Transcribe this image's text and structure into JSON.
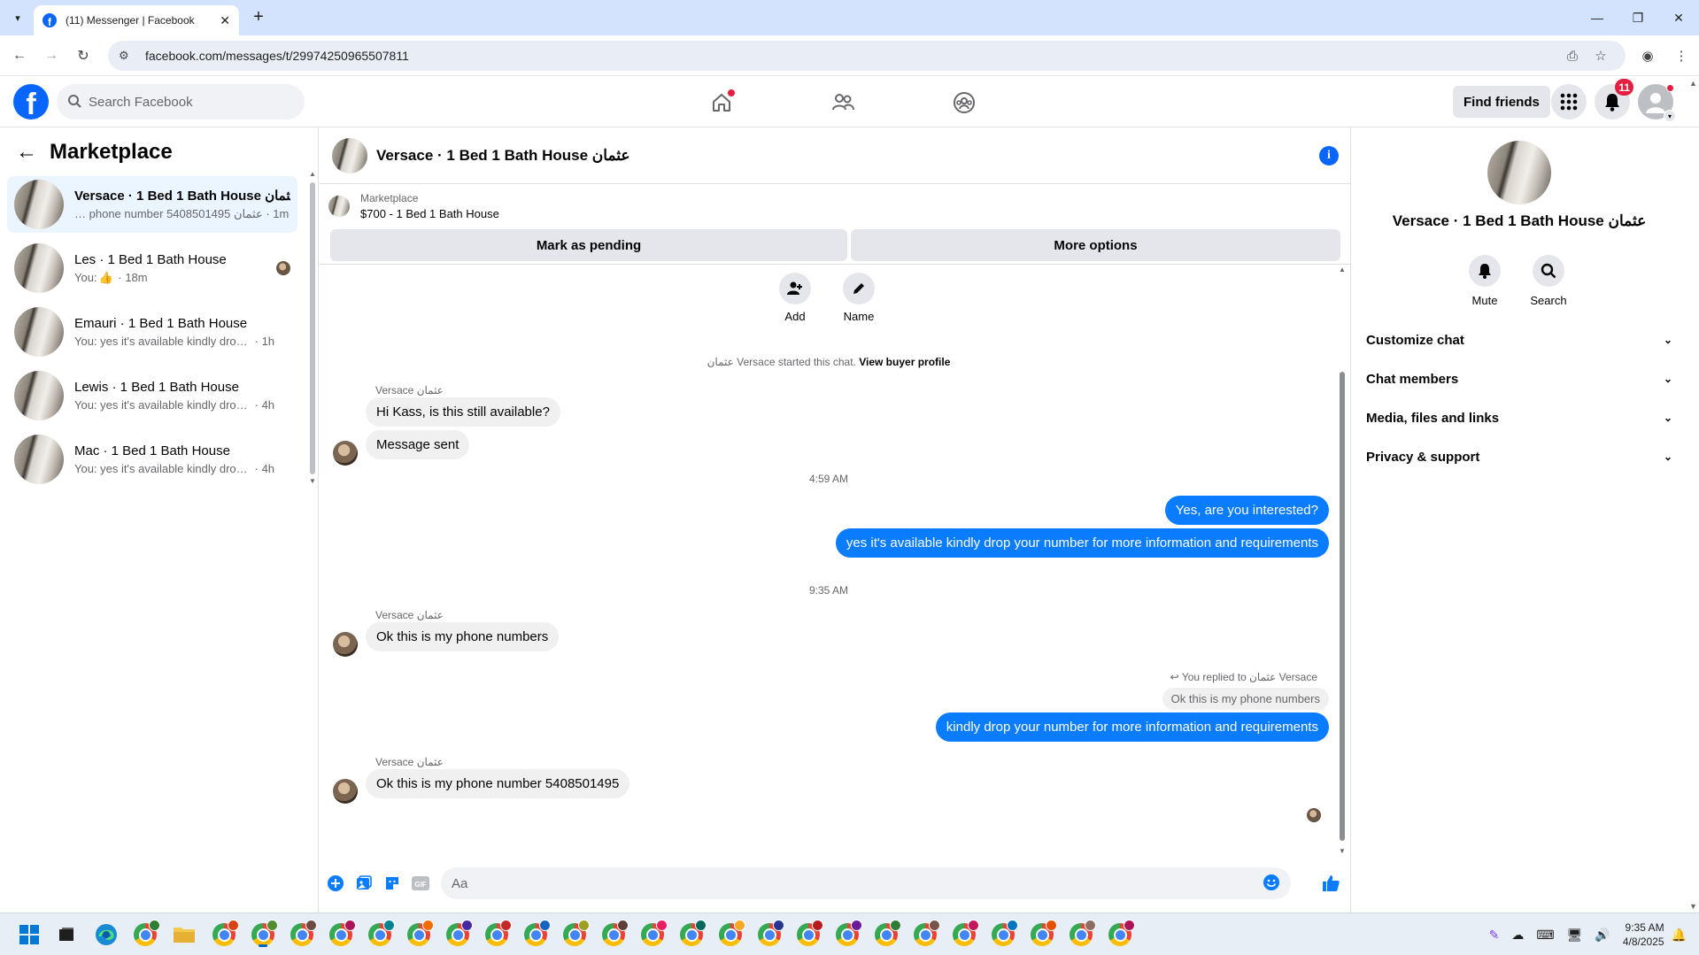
{
  "browser": {
    "tab_title": "(11) Messenger | Facebook",
    "url": "facebook.com/messages/t/29974250965507811"
  },
  "fb_header": {
    "search_placeholder": "Search Facebook",
    "find_friends_label": "Find friends",
    "notification_count": "11",
    "accent_color": "#0866ff"
  },
  "sidebar": {
    "title": "Marketplace",
    "conversations": [
      {
        "name": "Versace · 1 Bed 1 Bath House عثمان",
        "snippet": "phone number 5408501495 عثمان",
        "time": "1m",
        "active": true
      },
      {
        "name": "Les · 1 Bed 1 Bath House",
        "snippet": "You:",
        "time": "18m",
        "active": false
      },
      {
        "name": "Emauri · 1 Bed 1 Bath House",
        "snippet": "You: yes it's available kindly drop y...",
        "time": "1h",
        "active": false
      },
      {
        "name": "Lewis · 1 Bed 1 Bath House",
        "snippet": "You: yes it's available kindly drop y...",
        "time": "4h",
        "active": false
      },
      {
        "name": "Mac · 1 Bed 1 Bath House",
        "snippet": "You: yes it's available kindly drop y...",
        "time": "4h",
        "active": false
      }
    ]
  },
  "chat": {
    "title": "Versace · 1 Bed 1 Bath House عثمان",
    "marketplace_label": "Marketplace",
    "listing": "$700 - 1 Bed 1 Bath House",
    "mark_pending_label": "Mark as pending",
    "more_options_label": "More options",
    "add_label": "Add",
    "name_label": "Name",
    "started_text": "عثمان Versace started this chat.",
    "view_profile_label": "View buyer profile",
    "sender": "Versace عثمان",
    "messages": {
      "m1": "Hi Kass, is this still available?",
      "m2": "Message sent",
      "time1": "4:59 AM",
      "m3": "Yes, are you interested?",
      "m4": "yes it's available kindly drop your number for more information and requirements",
      "time2": "9:35 AM",
      "m5": "Ok this is my phone numbers",
      "reply_note": "You replied to عثمان Versace",
      "reply_quote": "Ok this is my phone numbers",
      "m6": "kindly drop your number for more information and requirements",
      "m7": "Ok this is my phone number 5408501495"
    },
    "composer_placeholder": "Aa",
    "bubble_color": "#0a7cff"
  },
  "right_panel": {
    "name": "Versace · 1 Bed 1 Bath House عثمان",
    "mute_label": "Mute",
    "search_label": "Search",
    "sections": [
      "Customize chat",
      "Chat members",
      "Media, files and links",
      "Privacy & support"
    ]
  },
  "taskbar": {
    "time": "9:35 AM",
    "date": "4/8/2025"
  }
}
